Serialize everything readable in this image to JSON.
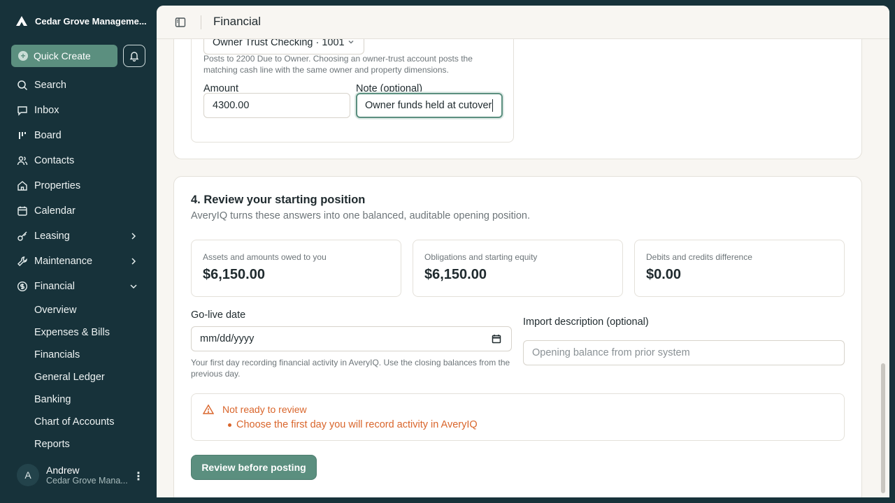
{
  "sidebar": {
    "org_name": "Cedar Grove Manageme...",
    "quick_create": "Quick Create",
    "nav": [
      {
        "label": "Search"
      },
      {
        "label": "Inbox"
      },
      {
        "label": "Board"
      },
      {
        "label": "Contacts"
      },
      {
        "label": "Properties"
      },
      {
        "label": "Calendar"
      },
      {
        "label": "Leasing"
      },
      {
        "label": "Maintenance"
      },
      {
        "label": "Financial"
      }
    ],
    "financial_sub": [
      "Overview",
      "Expenses & Bills",
      "Financials",
      "General Ledger",
      "Banking",
      "Chart of Accounts",
      "Reports"
    ],
    "user": {
      "initial": "A",
      "name": "Andrew",
      "org": "Cedar Grove Mana..."
    }
  },
  "topbar": {
    "title": "Financial"
  },
  "owner_funds": {
    "account_select": "Owner Trust Checking · 1001",
    "help": "Posts to 2200 Due to Owner. Choosing an owner-trust account posts the matching cash line with the same owner and property dimensions.",
    "amount_label": "Amount",
    "amount_value": "4300.00",
    "note_label": "Note (optional)",
    "note_value": "Owner funds held at cutover"
  },
  "review": {
    "title": "4. Review your starting position",
    "subtitle": "AveryIQ turns these answers into one balanced, auditable opening position.",
    "stats": [
      {
        "label": "Assets and amounts owed to you",
        "value": "$6,150.00"
      },
      {
        "label": "Obligations and starting equity",
        "value": "$6,150.00"
      },
      {
        "label": "Debits and credits difference",
        "value": "$0.00"
      }
    ],
    "golive_label": "Go-live date",
    "golive_placeholder": "mm/dd/yyyy",
    "golive_help": "Your first day recording financial activity in AveryIQ. Use the closing balances from the previous day.",
    "import_label": "Import description (optional)",
    "import_placeholder": "Opening balance from prior system",
    "alert_title": "Not ready to review",
    "alert_item": "Choose the first day you will record activity in AveryIQ",
    "review_button": "Review before posting"
  },
  "colors": {
    "accent": "#5b8f7f",
    "sidebar_bg": "#17323a",
    "warning": "#d9652b"
  }
}
